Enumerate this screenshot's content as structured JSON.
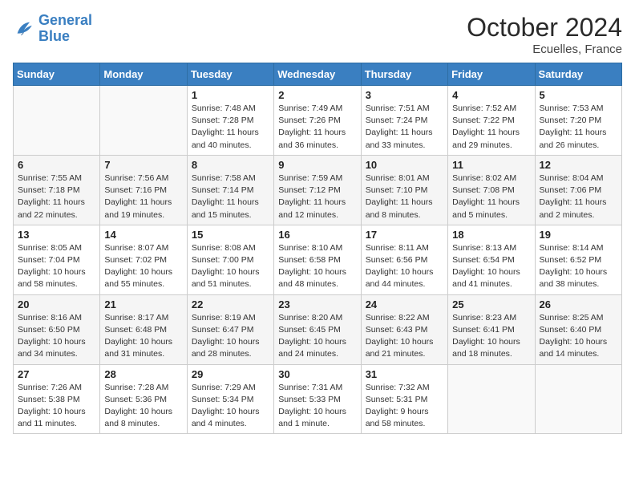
{
  "header": {
    "logo_line1": "General",
    "logo_line2": "Blue",
    "month": "October 2024",
    "location": "Ecuelles, France"
  },
  "weekdays": [
    "Sunday",
    "Monday",
    "Tuesday",
    "Wednesday",
    "Thursday",
    "Friday",
    "Saturday"
  ],
  "weeks": [
    [
      {
        "day": "",
        "info": ""
      },
      {
        "day": "",
        "info": ""
      },
      {
        "day": "1",
        "info": "Sunrise: 7:48 AM\nSunset: 7:28 PM\nDaylight: 11 hours\nand 40 minutes."
      },
      {
        "day": "2",
        "info": "Sunrise: 7:49 AM\nSunset: 7:26 PM\nDaylight: 11 hours\nand 36 minutes."
      },
      {
        "day": "3",
        "info": "Sunrise: 7:51 AM\nSunset: 7:24 PM\nDaylight: 11 hours\nand 33 minutes."
      },
      {
        "day": "4",
        "info": "Sunrise: 7:52 AM\nSunset: 7:22 PM\nDaylight: 11 hours\nand 29 minutes."
      },
      {
        "day": "5",
        "info": "Sunrise: 7:53 AM\nSunset: 7:20 PM\nDaylight: 11 hours\nand 26 minutes."
      }
    ],
    [
      {
        "day": "6",
        "info": "Sunrise: 7:55 AM\nSunset: 7:18 PM\nDaylight: 11 hours\nand 22 minutes."
      },
      {
        "day": "7",
        "info": "Sunrise: 7:56 AM\nSunset: 7:16 PM\nDaylight: 11 hours\nand 19 minutes."
      },
      {
        "day": "8",
        "info": "Sunrise: 7:58 AM\nSunset: 7:14 PM\nDaylight: 11 hours\nand 15 minutes."
      },
      {
        "day": "9",
        "info": "Sunrise: 7:59 AM\nSunset: 7:12 PM\nDaylight: 11 hours\nand 12 minutes."
      },
      {
        "day": "10",
        "info": "Sunrise: 8:01 AM\nSunset: 7:10 PM\nDaylight: 11 hours\nand 8 minutes."
      },
      {
        "day": "11",
        "info": "Sunrise: 8:02 AM\nSunset: 7:08 PM\nDaylight: 11 hours\nand 5 minutes."
      },
      {
        "day": "12",
        "info": "Sunrise: 8:04 AM\nSunset: 7:06 PM\nDaylight: 11 hours\nand 2 minutes."
      }
    ],
    [
      {
        "day": "13",
        "info": "Sunrise: 8:05 AM\nSunset: 7:04 PM\nDaylight: 10 hours\nand 58 minutes."
      },
      {
        "day": "14",
        "info": "Sunrise: 8:07 AM\nSunset: 7:02 PM\nDaylight: 10 hours\nand 55 minutes."
      },
      {
        "day": "15",
        "info": "Sunrise: 8:08 AM\nSunset: 7:00 PM\nDaylight: 10 hours\nand 51 minutes."
      },
      {
        "day": "16",
        "info": "Sunrise: 8:10 AM\nSunset: 6:58 PM\nDaylight: 10 hours\nand 48 minutes."
      },
      {
        "day": "17",
        "info": "Sunrise: 8:11 AM\nSunset: 6:56 PM\nDaylight: 10 hours\nand 44 minutes."
      },
      {
        "day": "18",
        "info": "Sunrise: 8:13 AM\nSunset: 6:54 PM\nDaylight: 10 hours\nand 41 minutes."
      },
      {
        "day": "19",
        "info": "Sunrise: 8:14 AM\nSunset: 6:52 PM\nDaylight: 10 hours\nand 38 minutes."
      }
    ],
    [
      {
        "day": "20",
        "info": "Sunrise: 8:16 AM\nSunset: 6:50 PM\nDaylight: 10 hours\nand 34 minutes."
      },
      {
        "day": "21",
        "info": "Sunrise: 8:17 AM\nSunset: 6:48 PM\nDaylight: 10 hours\nand 31 minutes."
      },
      {
        "day": "22",
        "info": "Sunrise: 8:19 AM\nSunset: 6:47 PM\nDaylight: 10 hours\nand 28 minutes."
      },
      {
        "day": "23",
        "info": "Sunrise: 8:20 AM\nSunset: 6:45 PM\nDaylight: 10 hours\nand 24 minutes."
      },
      {
        "day": "24",
        "info": "Sunrise: 8:22 AM\nSunset: 6:43 PM\nDaylight: 10 hours\nand 21 minutes."
      },
      {
        "day": "25",
        "info": "Sunrise: 8:23 AM\nSunset: 6:41 PM\nDaylight: 10 hours\nand 18 minutes."
      },
      {
        "day": "26",
        "info": "Sunrise: 8:25 AM\nSunset: 6:40 PM\nDaylight: 10 hours\nand 14 minutes."
      }
    ],
    [
      {
        "day": "27",
        "info": "Sunrise: 7:26 AM\nSunset: 5:38 PM\nDaylight: 10 hours\nand 11 minutes."
      },
      {
        "day": "28",
        "info": "Sunrise: 7:28 AM\nSunset: 5:36 PM\nDaylight: 10 hours\nand 8 minutes."
      },
      {
        "day": "29",
        "info": "Sunrise: 7:29 AM\nSunset: 5:34 PM\nDaylight: 10 hours\nand 4 minutes."
      },
      {
        "day": "30",
        "info": "Sunrise: 7:31 AM\nSunset: 5:33 PM\nDaylight: 10 hours\nand 1 minute."
      },
      {
        "day": "31",
        "info": "Sunrise: 7:32 AM\nSunset: 5:31 PM\nDaylight: 9 hours\nand 58 minutes."
      },
      {
        "day": "",
        "info": ""
      },
      {
        "day": "",
        "info": ""
      }
    ]
  ]
}
